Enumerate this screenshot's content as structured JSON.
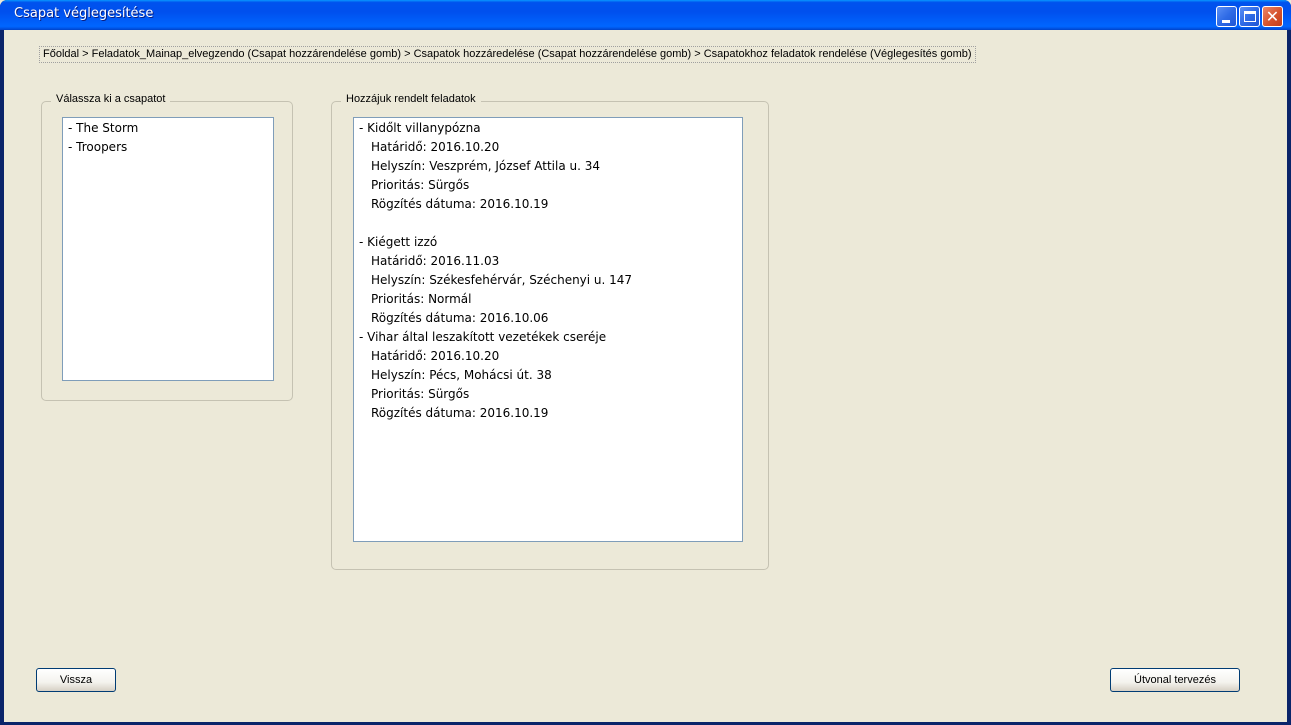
{
  "window": {
    "title": "Csapat véglegesítése"
  },
  "breadcrumb": {
    "text": "Főoldal > Feladatok_Mainap_elvegzendo (Csapat hozzárendelése gomb)  > Csapatok hozzáredelése (Csapat hozzárendelése gomb) > Csapatokhoz feladatok rendelése (Véglegesítés gomb)"
  },
  "teams": {
    "legend": "Válassza ki a csapatot",
    "items": [
      "- The Storm",
      "- Troopers"
    ]
  },
  "tasks": {
    "legend": "Hozzájuk rendelt feladatok",
    "items": [
      {
        "name": "- Kidőlt villanypózna",
        "deadline": "Határidő: 2016.10.20",
        "location": "Helyszín: Veszprém, József Attila u. 34",
        "priority": "Prioritás: Sürgős",
        "recorded": "Rögzítés dátuma: 2016.10.19"
      },
      {
        "name": "- Kiégett izzó",
        "deadline": "Határidő: 2016.11.03",
        "location": "Helyszín: Székesfehérvár, Széchenyi u. 147",
        "priority": "Prioritás: Normál",
        "recorded": "Rögzítés dátuma: 2016.10.06"
      },
      {
        "name": "- Vihar által leszakított vezetékek cseréje",
        "deadline": "Határidő: 2016.10.20",
        "location": "Helyszín: Pécs, Mohácsi út. 38",
        "priority": "Prioritás: Sürgős",
        "recorded": "Rögzítés dátuma: 2016.10.19"
      }
    ]
  },
  "buttons": {
    "back": "Vissza",
    "route": "Útvonal tervezés"
  }
}
